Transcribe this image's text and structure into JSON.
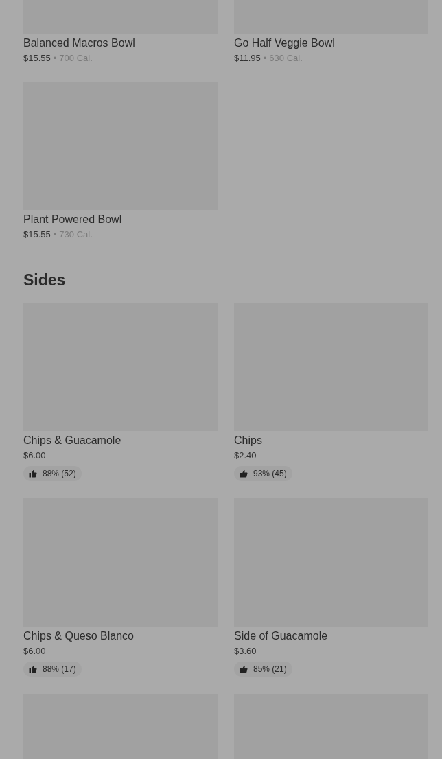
{
  "sections": [
    {
      "items": [
        {
          "kind": "card",
          "name": "Balanced Macros Bowl",
          "price": "$15.55",
          "separator": "•",
          "calories": "700 Cal."
        },
        {
          "kind": "card",
          "name": "Go Half Veggie Bowl",
          "price": "$11.95",
          "separator": "•",
          "calories": "630 Cal."
        },
        {
          "kind": "card",
          "name": "Plant Powered Bowl",
          "price": "$15.55",
          "separator": "•",
          "calories": "730 Cal."
        }
      ]
    },
    {
      "title": "Sides",
      "items": [
        {
          "kind": "card",
          "name": "Chips & Guacamole",
          "price": "$6.00",
          "rating": "88% (52)"
        },
        {
          "kind": "card",
          "name": "Chips",
          "price": "$2.40",
          "rating": "93% (45)"
        },
        {
          "kind": "card",
          "name": "Chips & Queso Blanco",
          "price": "$6.00",
          "rating": "88% (17)"
        },
        {
          "kind": "card",
          "name": "Side of Guacamole",
          "price": "$3.60",
          "rating": "85% (21)"
        },
        {
          "kind": "image"
        },
        {
          "kind": "image"
        }
      ]
    }
  ]
}
